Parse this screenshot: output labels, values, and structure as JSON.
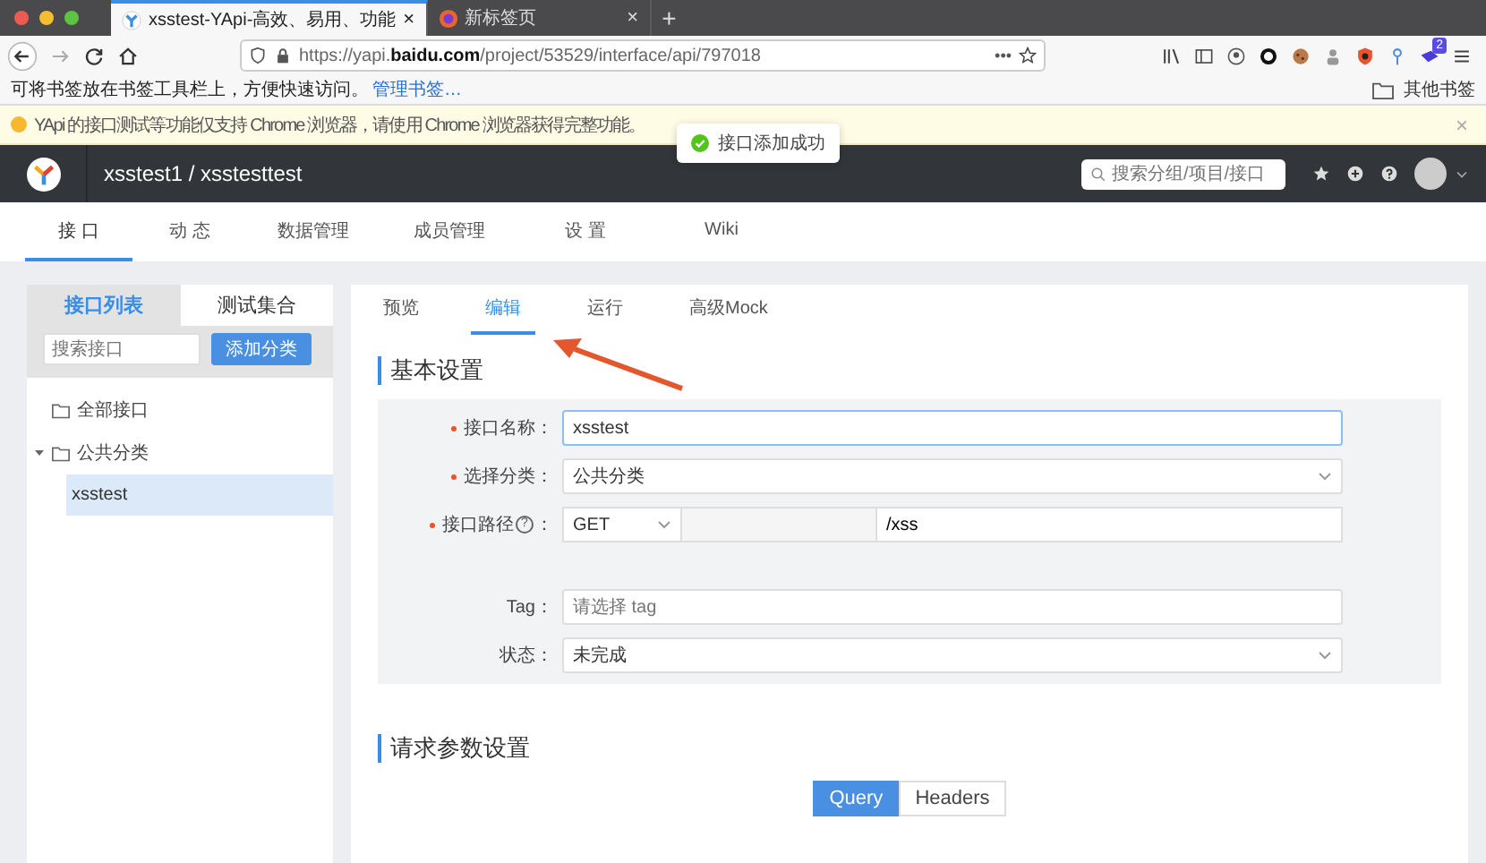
{
  "browser": {
    "tabs": [
      {
        "title": "xsstest-YApi-高效、易用、功能",
        "selected": true,
        "close": "×"
      },
      {
        "title": "新标签页",
        "selected": false,
        "close": "×"
      }
    ],
    "new_tab": "+",
    "url": "https://yapi.**baidu.com**/project/53529/interface/api/797018",
    "page_actions": "•••",
    "extension_badge": "2",
    "bookmarks_hint": "可将书签放在书签工具栏上，方便快速访问。",
    "bookmarks_link": "管理书签…",
    "other_bookmarks": "其他书签"
  },
  "notice": {
    "text": "YApi 的接口测试等功能仅支持 Chrome 浏览器，请使用 Chrome 浏览器获得完整功能。",
    "close": "×"
  },
  "toast": {
    "text": "接口添加成功"
  },
  "header": {
    "project_path": "xsstest1 / xsstesttest",
    "search_placeholder": "搜索分组/项目/接口"
  },
  "nav": [
    {
      "label": "接 口",
      "selected": true
    },
    {
      "label": "动 态",
      "selected": false
    },
    {
      "label": "数据管理",
      "selected": false
    },
    {
      "label": "成员管理",
      "selected": false
    },
    {
      "label": "设 置",
      "selected": false
    },
    {
      "label": "Wiki",
      "selected": false
    }
  ],
  "sidebar": {
    "tabs": [
      {
        "label": "接口列表",
        "selected": true
      },
      {
        "label": "测试集合",
        "selected": false
      }
    ],
    "search_placeholder": "搜索接口",
    "add_button": "添加分类",
    "tree": [
      {
        "label": "全部接口",
        "selected": false
      },
      {
        "label": "公共分类",
        "selected": false,
        "expanded": true,
        "children": [
          {
            "label": "xsstest",
            "selected": true
          }
        ]
      }
    ]
  },
  "main": {
    "tabs": [
      {
        "label": "预览",
        "selected": false
      },
      {
        "label": "编辑",
        "selected": true
      },
      {
        "label": "运行",
        "selected": false
      },
      {
        "label": "高级Mock",
        "selected": false
      }
    ],
    "basic_title": "基本设置",
    "fields": [
      {
        "kind": "input",
        "label": "接口名称：",
        "required": true,
        "value": "xsstest",
        "focused": true
      },
      {
        "kind": "select",
        "label": "选择分类：",
        "required": true,
        "value": "公共分类"
      },
      {
        "kind": "path",
        "label": "接口路径",
        "help": "?",
        "suffix": "：",
        "required": true,
        "method": "GET",
        "path": "/xss"
      },
      {
        "kind": "input",
        "label": "Tag：",
        "required": false,
        "placeholder": "请选择 tag",
        "focused": false
      },
      {
        "kind": "select",
        "label": "状态：",
        "required": false,
        "value": "未完成"
      }
    ],
    "request_title": "请求参数设置",
    "param_tabs": [
      {
        "label": "Query",
        "selected": true
      },
      {
        "label": "Headers",
        "selected": false
      }
    ]
  }
}
